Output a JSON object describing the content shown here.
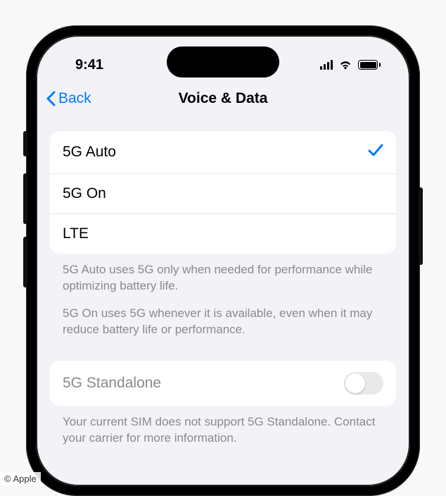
{
  "statusbar": {
    "time": "9:41"
  },
  "nav": {
    "back_label": "Back",
    "title": "Voice & Data"
  },
  "options": {
    "items": [
      {
        "label": "5G Auto",
        "selected": true
      },
      {
        "label": "5G On",
        "selected": false
      },
      {
        "label": "LTE",
        "selected": false
      }
    ],
    "footer1": "5G Auto uses 5G only when needed for performance while optimizing battery life.",
    "footer2": "5G On uses 5G whenever it is available, even when it may reduce battery life or performance."
  },
  "standalone": {
    "label": "5G Standalone",
    "enabled": false,
    "footer": "Your current SIM does not support 5G Standalone. Contact your carrier for more information."
  },
  "attribution": "© Apple"
}
